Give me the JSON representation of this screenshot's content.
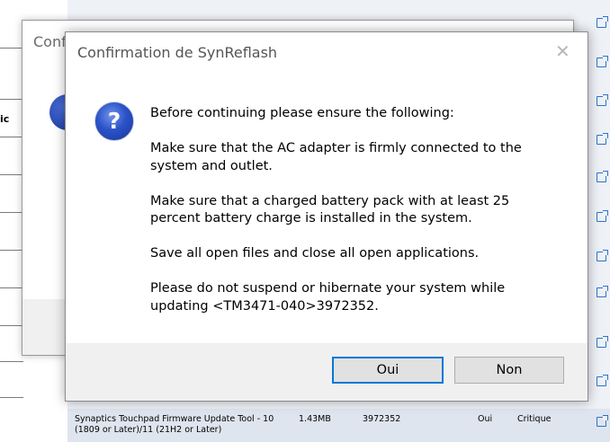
{
  "background": {
    "left_fragment": "ic",
    "table_row": {
      "name": "Synaptics Touchpad Firmware Update Tool - 10 (1809 or Later)/11 (21H2 or Later)",
      "size": "1.43MB",
      "version": "3972352",
      "installed": "Oui",
      "priority": "Critique"
    },
    "link_icon": "external-link-icon"
  },
  "back_dialog": {
    "title": "Conf"
  },
  "dialog": {
    "title": "Confirmation de SynReflash",
    "close_icon": "close-icon",
    "icon": "question-icon",
    "messages": [
      "Before continuing please ensure the following:",
      "Make sure that the AC adapter is firmly connected to the\nsystem and outlet.",
      "Make sure that a charged battery pack with at least 25\npercent battery charge is installed in the system.",
      "Save all open files and close all open applications.",
      "Please do not suspend or hibernate your system while\nupdating <TM3471-040>3972352."
    ],
    "buttons": {
      "yes": "Oui",
      "no": "Non"
    }
  },
  "colors": {
    "accent": "#0078d7",
    "link": "#2c73c8"
  }
}
